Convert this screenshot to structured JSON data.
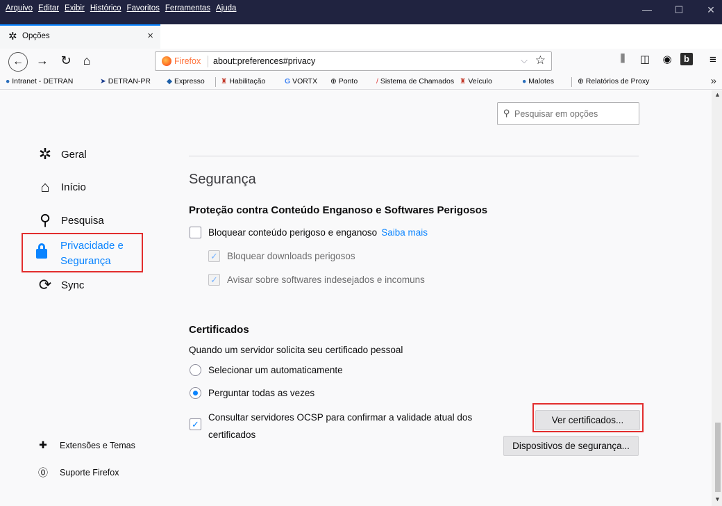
{
  "menu": [
    "Arquivo",
    "Editar",
    "Exibir",
    "Histórico",
    "Favoritos",
    "Ferramentas",
    "Ajuda"
  ],
  "window_controls": {
    "minimize": "—",
    "maximize": "☐",
    "close": "✕"
  },
  "tab": {
    "title": "Opções",
    "close": "×"
  },
  "newtab": "+",
  "nav": {
    "back": "←",
    "forward": "→",
    "reload": "↻",
    "home": "⌂"
  },
  "urlbar": {
    "identity": "Firefox",
    "url": "about:preferences#privacy",
    "dropdown": "⌵",
    "star": "☆"
  },
  "toolbar_icons": [
    "⫼",
    "◫",
    "◉",
    "b",
    "≡"
  ],
  "bookmarks": [
    "Intranet - DETRAN",
    "DETRAN-PR",
    "Expresso",
    "Habilitação",
    "VORTX",
    "Ponto",
    "Sistema de Chamados",
    "Veículo",
    "Malotes",
    "Relatórios de Proxy"
  ],
  "bookmarks_more": "»",
  "search": {
    "placeholder": "Pesquisar em opções"
  },
  "sidebar": {
    "items": [
      {
        "label": "Geral",
        "icon": "gear-icon"
      },
      {
        "label": "Início",
        "icon": "home-icon"
      },
      {
        "label": "Pesquisa",
        "icon": "search-icon"
      },
      {
        "label": "Privacidade e Segurança",
        "icon": "lock-icon"
      },
      {
        "label": "Sync",
        "icon": "sync-icon"
      }
    ],
    "footer": [
      {
        "label": "Extensões e Temas",
        "icon": "puzzle-icon"
      },
      {
        "label": "Suporte Firefox",
        "icon": "help-icon"
      }
    ]
  },
  "security": {
    "heading": "Segurança",
    "deceptive_title": "Proteção contra Conteúdo Enganoso e Softwares Perigosos",
    "block_dangerous": "Bloquear conteúdo perigoso e enganoso",
    "learn_more": "Saiba mais",
    "block_downloads": "Bloquear downloads perigosos",
    "warn_unwanted": "Avisar sobre softwares indesejados e incomuns"
  },
  "certificates": {
    "title": "Certificados",
    "description": "Quando um servidor solicita seu certificado pessoal",
    "auto_select": "Selecionar um automaticamente",
    "ask_every": "Perguntar todas as vezes",
    "ocsp_line1": "Consultar servidores OCSP para confirmar a validade atual dos",
    "ocsp_line2": "certificados",
    "view_button": "Ver certificados...",
    "devices_button": "Dispositivos de segurança..."
  },
  "colors": {
    "accent": "#0a84ff",
    "highlight": "#e22d2d",
    "titlebar": "#202340"
  }
}
